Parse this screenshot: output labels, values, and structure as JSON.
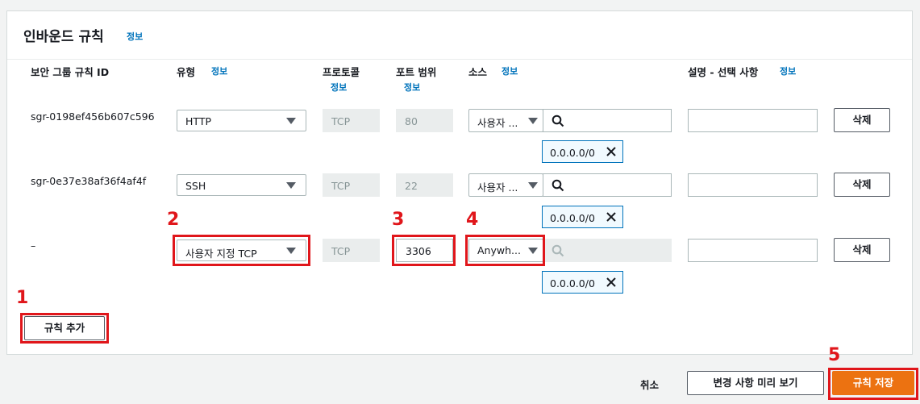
{
  "panel": {
    "title": "인바운드 규칙",
    "info": "정보"
  },
  "columns": {
    "rule_id": "보안 그룹 규칙 ID",
    "type": "유형",
    "type_info": "정보",
    "protocol": "프로토콜",
    "protocol_info": "정보",
    "port_range": "포트 범위",
    "port_info": "정보",
    "source": "소스",
    "source_info": "정보",
    "description": "설명 - 선택 사항",
    "description_info": "정보"
  },
  "rules": [
    {
      "id": "sgr-0198ef456b607c596",
      "type": "HTTP",
      "protocol": "TCP",
      "port": "80",
      "source_type": "사용자 ...",
      "cidr": "0.0.0.0/0",
      "description": "",
      "delete_label": "삭제"
    },
    {
      "id": "sgr-0e37e38af36f4af4f",
      "type": "SSH",
      "protocol": "TCP",
      "port": "22",
      "source_type": "사용자 ...",
      "cidr": "0.0.0.0/0",
      "description": "",
      "delete_label": "삭제"
    },
    {
      "id": "–",
      "type": "사용자 지정 TCP",
      "protocol": "TCP",
      "port": "3306",
      "source_type": "Anywh...",
      "cidr": "0.0.0.0/0",
      "description": "",
      "delete_label": "삭제"
    }
  ],
  "add_rule_label": "규칙 추가",
  "footer": {
    "cancel": "취소",
    "preview": "변경 사항 미리 보기",
    "save": "규칙 저장"
  },
  "annotations": [
    "1",
    "2",
    "3",
    "4",
    "5"
  ],
  "colors": {
    "accent": "#ec7211",
    "link": "#0073bb",
    "highlight": "#e0161b"
  }
}
